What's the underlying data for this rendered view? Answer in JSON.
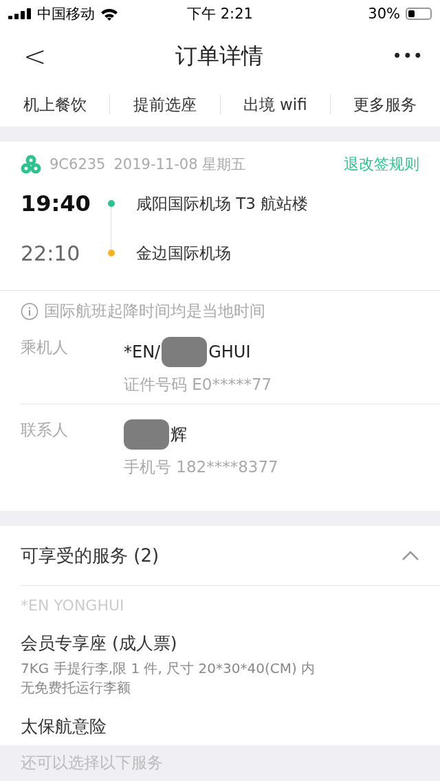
{
  "status_bar": {
    "carrier": "中国移动",
    "time": "下午 2:21",
    "battery_percent": "30%"
  },
  "nav": {
    "back": "<",
    "title": "订单详情",
    "more": "•••"
  },
  "service_tabs": [
    "机上餐饮",
    "提前选座",
    "出境 wifi",
    "更多服务"
  ],
  "flight": {
    "number": "9C6235",
    "date": "2019-11-08 星期五",
    "rules_link": "退改签规则",
    "stops": [
      {
        "time": "19:40",
        "airport": "咸阳国际机场 T3 航站楼",
        "color": "#2ec28f",
        "kind": "departure"
      },
      {
        "time": "22:10",
        "airport": "金边国际机场",
        "color": "#f5b41f",
        "kind": "arrival"
      }
    ]
  },
  "notice": "国际航班起降时间均是当地时间",
  "people": [
    {
      "label": "乘机人",
      "name_parts": [
        "*EN/",
        "GHUI"
      ],
      "detail": "证件号码 E0*****77"
    },
    {
      "label": "联系人",
      "name_parts": [
        "辉"
      ],
      "detail": "手机号 182****8377"
    }
  ],
  "services": {
    "title": "可享受的服务 (2)",
    "expanded": true,
    "passenger": "*EN YONGHUI",
    "items": [
      {
        "name": "会员专享座 (成人票)",
        "lines": [
          "7KG 手提行李,限 1 件, 尺寸 20*30*40(CM) 内",
          "无免费托运行李额"
        ]
      },
      {
        "name": "太保航意险"
      }
    ]
  },
  "more_services_title": "还可以选择以下服务"
}
